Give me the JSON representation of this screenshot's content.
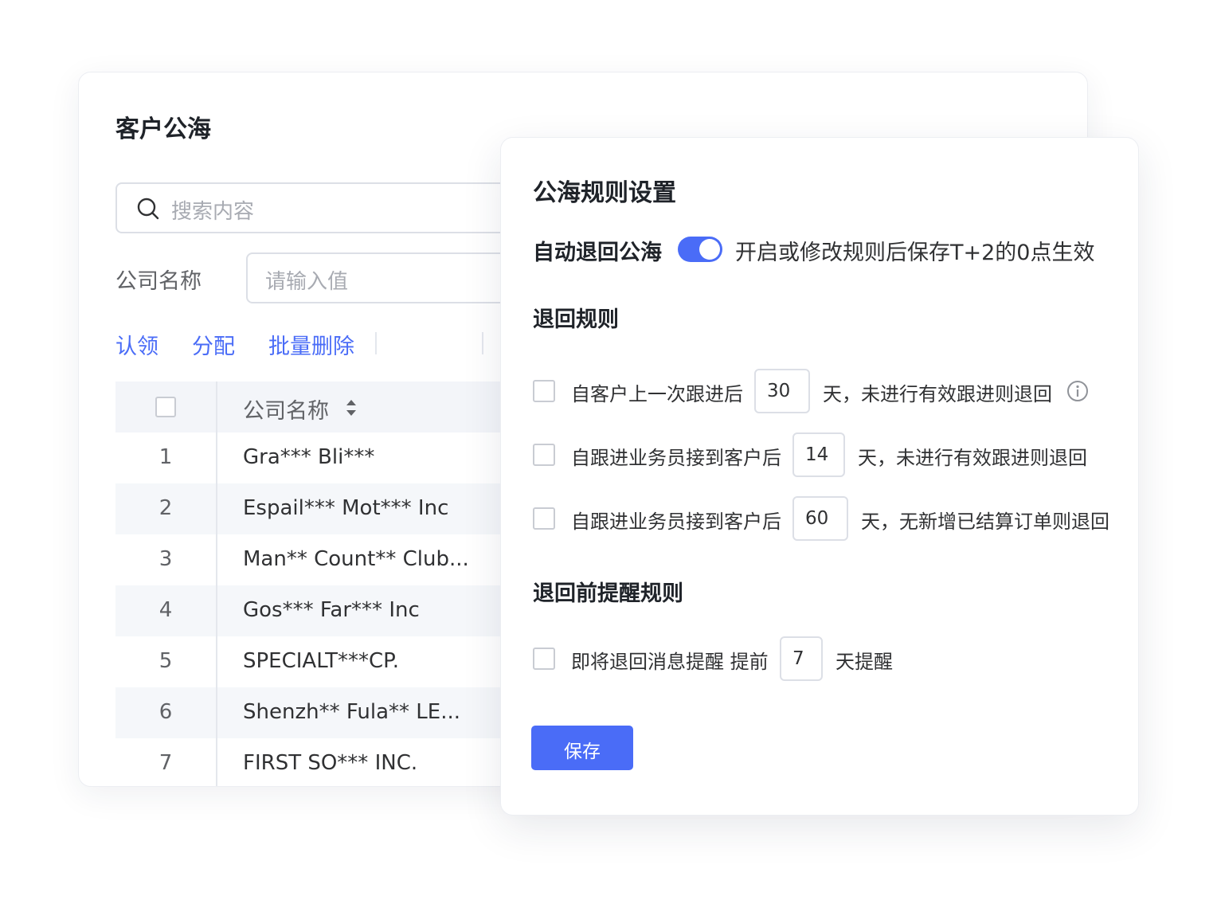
{
  "customer_pool": {
    "title": "客户公海",
    "search_placeholder": "搜索内容",
    "company_filter_label": "公司名称",
    "company_filter_placeholder": "请输入值",
    "actions": [
      "认领",
      "分配",
      "批量删除"
    ],
    "table": {
      "column_name": "公司名称",
      "rows": [
        {
          "index": "1",
          "name": "Gra*** Bli***"
        },
        {
          "index": "2",
          "name": "Espail*** Mot*** Inc"
        },
        {
          "index": "3",
          "name": "Man** Count** Club..."
        },
        {
          "index": "4",
          "name": "Gos*** Far*** Inc"
        },
        {
          "index": "5",
          "name": "SPECIALT***CP."
        },
        {
          "index": "6",
          "name": "Shenzh** Fula** LE..."
        },
        {
          "index": "7",
          "name": "FIRST SO*** INC."
        }
      ]
    }
  },
  "rule_panel": {
    "title": "公海规则设置",
    "auto_return_label": "自动退回公海",
    "auto_return_enabled": true,
    "auto_return_desc": "开启或修改规则后保存T+2的0点生效",
    "return_rules_title": "退回规则",
    "rules": [
      {
        "prefix": "自客户上一次跟进后",
        "days": "30",
        "suffix": "天，未进行有效跟进则退回"
      },
      {
        "prefix": "自跟进业务员接到客户后",
        "days": "14",
        "suffix": "天，未进行有效跟进则退回"
      },
      {
        "prefix": "自跟进业务员接到客户后",
        "days": "60",
        "suffix": "天，无新增已结算订单则退回"
      }
    ],
    "reminder_title": "退回前提醒规则",
    "reminder": {
      "prefix": "即将退回消息提醒 提前",
      "days": "7",
      "suffix": "天提醒"
    },
    "save_label": "保存"
  },
  "colors": {
    "accent": "#4a6cf7"
  }
}
